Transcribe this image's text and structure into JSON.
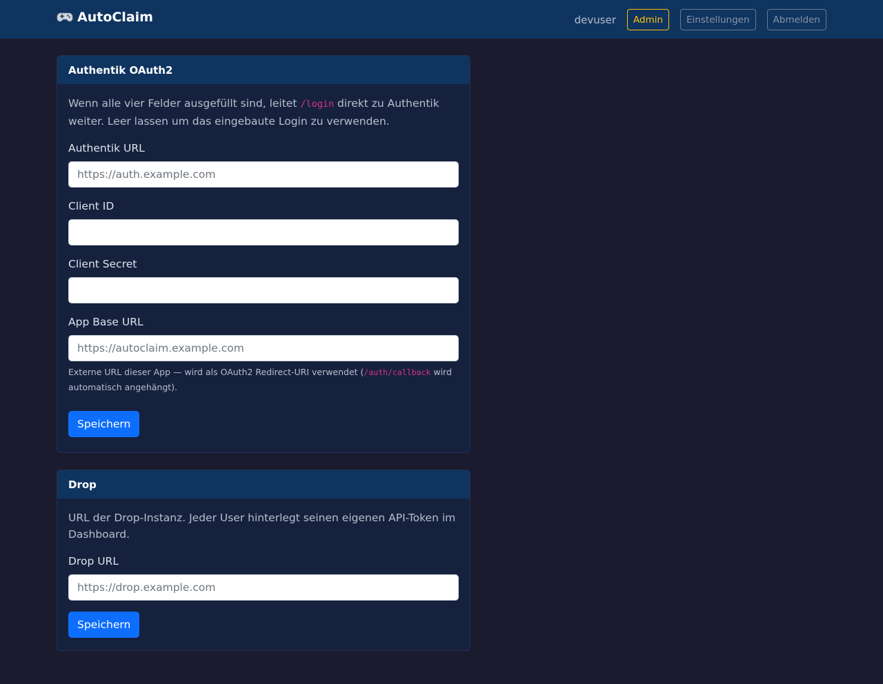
{
  "navbar": {
    "brand": "AutoClaim",
    "brand_icon": "gamepad-icon",
    "username": "devuser",
    "admin_label": "Admin",
    "settings_label": "Einstellungen",
    "logout_label": "Abmelden",
    "accent_color": "#ffc107",
    "background_color": "#0f3460"
  },
  "authentik": {
    "title": "Authentik OAuth2",
    "intro_before": "Wenn alle vier Felder ausgefüllt sind, leitet ",
    "intro_code": "/login",
    "intro_after": " direkt zu Authentik weiter. Leer lassen um das eingebaute Login zu verwenden.",
    "url_label": "Authentik URL",
    "url_placeholder": "https://auth.example.com",
    "url_value": "",
    "client_id_label": "Client ID",
    "client_id_value": "",
    "client_secret_label": "Client Secret",
    "client_secret_value": "",
    "base_url_label": "App Base URL",
    "base_url_placeholder": "https://autoclaim.example.com",
    "base_url_value": "",
    "hint_before": "Externe URL dieser App — wird als OAuth2 Redirect-URI verwendet (",
    "hint_code": "/auth/callback",
    "hint_after": " wird automatisch angehängt).",
    "save_label": "Speichern"
  },
  "drop": {
    "title": "Drop",
    "intro": "URL der Drop-Instanz. Jeder User hinterlegt seinen eigenen API-Token im Dashboard.",
    "url_label": "Drop URL",
    "url_placeholder": "https://drop.example.com",
    "url_value": "",
    "save_label": "Speichern"
  },
  "colors": {
    "page_background": "#1a1b2e",
    "card_background": "#16213e",
    "primary_button": "#0d6efd",
    "code_color": "#d63384"
  }
}
